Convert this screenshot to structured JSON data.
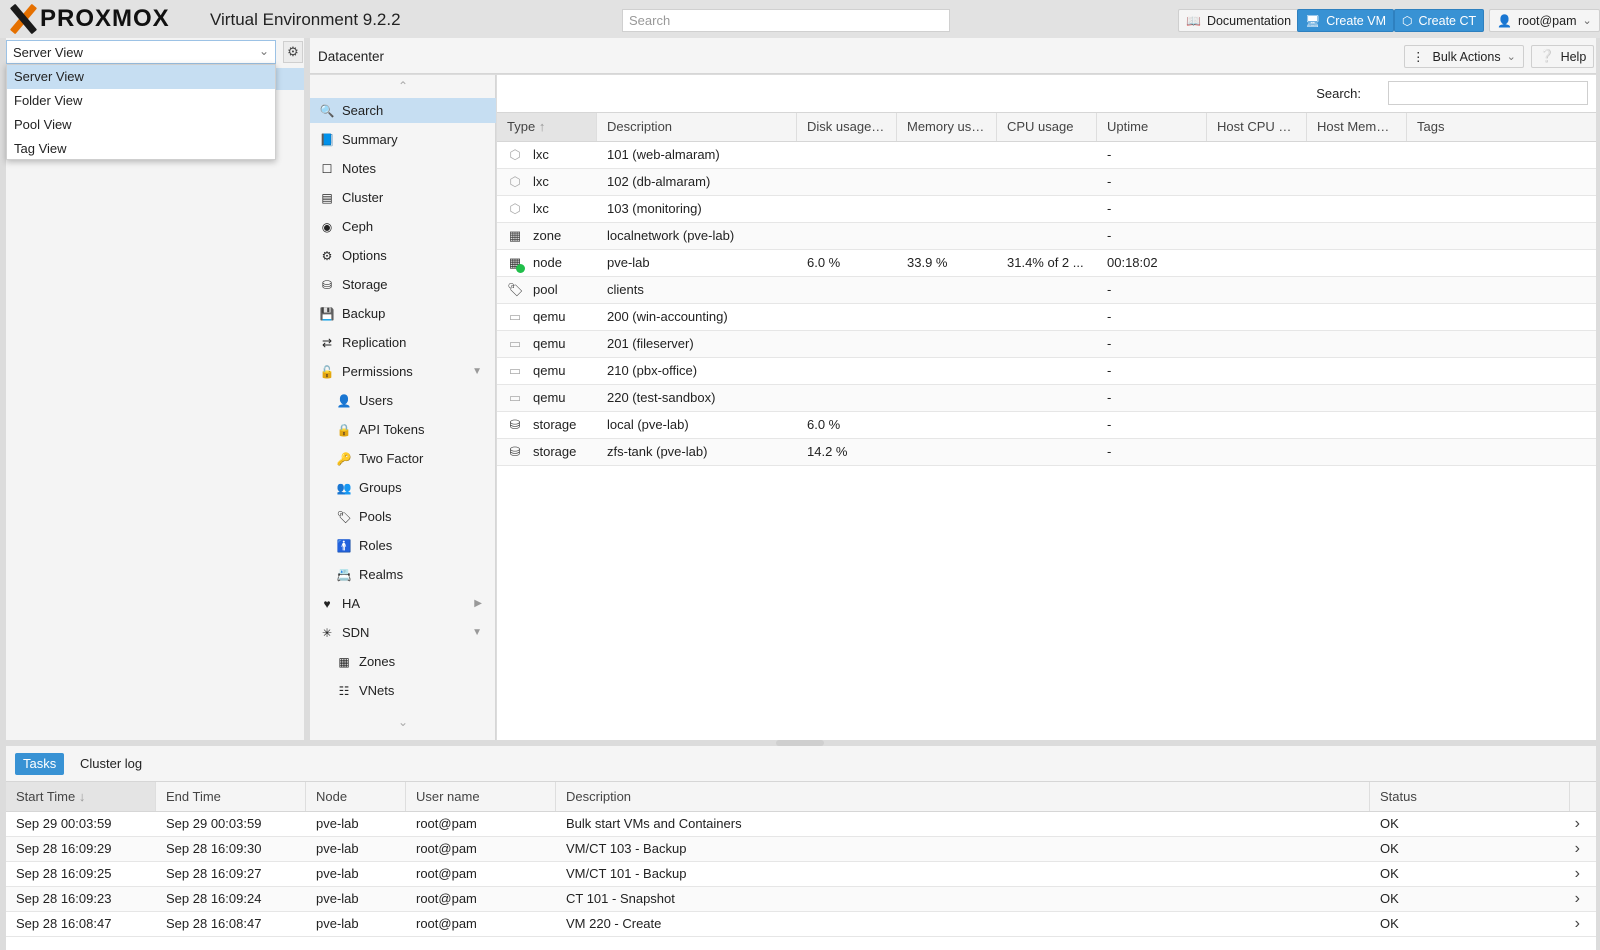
{
  "header": {
    "logo_text": "PROXMOX",
    "app_title": "Virtual Environment 9.2.2",
    "search_placeholder": "Search",
    "documentation_label": "Documentation",
    "create_vm_label": "Create VM",
    "create_ct_label": "Create CT",
    "user_label": "root@pam"
  },
  "view_selector": {
    "selected": "Server View",
    "options": [
      "Server View",
      "Folder View",
      "Pool View",
      "Tag View"
    ]
  },
  "content": {
    "title": "Datacenter",
    "bulk_actions_label": "Bulk Actions",
    "help_label": "Help"
  },
  "nav": {
    "items": [
      {
        "label": "Search",
        "icon": "search-icon"
      },
      {
        "label": "Summary",
        "icon": "book-icon"
      },
      {
        "label": "Notes",
        "icon": "note-icon"
      },
      {
        "label": "Cluster",
        "icon": "server-icon"
      },
      {
        "label": "Ceph",
        "icon": "ceph-icon"
      },
      {
        "label": "Options",
        "icon": "gear-icon"
      },
      {
        "label": "Storage",
        "icon": "database-icon"
      },
      {
        "label": "Backup",
        "icon": "floppy-icon"
      },
      {
        "label": "Replication",
        "icon": "retweet-icon"
      },
      {
        "label": "Permissions",
        "icon": "unlock-icon"
      },
      {
        "label": "Users",
        "icon": "user-icon"
      },
      {
        "label": "API Tokens",
        "icon": "lock-icon"
      },
      {
        "label": "Two Factor",
        "icon": "key-icon"
      },
      {
        "label": "Groups",
        "icon": "users-icon"
      },
      {
        "label": "Pools",
        "icon": "tags-icon"
      },
      {
        "label": "Roles",
        "icon": "male-icon"
      },
      {
        "label": "Realms",
        "icon": "address-book-icon"
      },
      {
        "label": "HA",
        "icon": "heartbeat-icon"
      },
      {
        "label": "SDN",
        "icon": "sdn-icon"
      },
      {
        "label": "Zones",
        "icon": "grid-icon"
      },
      {
        "label": "VNets",
        "icon": "network-icon"
      }
    ]
  },
  "grid": {
    "search_label": "Search:",
    "search_value": "",
    "columns": [
      "Type",
      "Description",
      "Disk usage…",
      "Memory us…",
      "CPU usage",
      "Uptime",
      "Host CPU …",
      "Host Mem…",
      "Tags"
    ],
    "rows": [
      {
        "type": "lxc",
        "icon": "container-icon",
        "description": "101 (web-almaram)",
        "disk": "",
        "memory": "",
        "cpu": "",
        "uptime": "-"
      },
      {
        "type": "lxc",
        "icon": "container-icon",
        "description": "102 (db-almaram)",
        "disk": "",
        "memory": "",
        "cpu": "",
        "uptime": "-"
      },
      {
        "type": "lxc",
        "icon": "container-icon",
        "description": "103 (monitoring)",
        "disk": "",
        "memory": "",
        "cpu": "",
        "uptime": "-"
      },
      {
        "type": "zone",
        "icon": "grid-icon",
        "description": "localnetwork (pve-lab)",
        "disk": "",
        "memory": "",
        "cpu": "",
        "uptime": "-"
      },
      {
        "type": "node",
        "icon": "node-online-icon",
        "description": "pve-lab",
        "disk": "6.0 %",
        "memory": "33.9 %",
        "cpu": "31.4% of 2 ...",
        "uptime": "00:18:02"
      },
      {
        "type": "pool",
        "icon": "tags-icon",
        "description": "clients",
        "disk": "",
        "memory": "",
        "cpu": "",
        "uptime": "-"
      },
      {
        "type": "qemu",
        "icon": "monitor-icon",
        "description": "200 (win-accounting)",
        "disk": "",
        "memory": "",
        "cpu": "",
        "uptime": "-"
      },
      {
        "type": "qemu",
        "icon": "monitor-icon",
        "description": "201 (fileserver)",
        "disk": "",
        "memory": "",
        "cpu": "",
        "uptime": "-"
      },
      {
        "type": "qemu",
        "icon": "monitor-icon",
        "description": "210 (pbx-office)",
        "disk": "",
        "memory": "",
        "cpu": "",
        "uptime": "-"
      },
      {
        "type": "qemu",
        "icon": "monitor-icon",
        "description": "220 (test-sandbox)",
        "disk": "",
        "memory": "",
        "cpu": "",
        "uptime": "-"
      },
      {
        "type": "storage",
        "icon": "database-icon",
        "description": "local (pve-lab)",
        "disk": "6.0 %",
        "memory": "",
        "cpu": "",
        "uptime": "-"
      },
      {
        "type": "storage",
        "icon": "database-icon",
        "description": "zfs-tank (pve-lab)",
        "disk": "14.2 %",
        "memory": "",
        "cpu": "",
        "uptime": "-"
      }
    ]
  },
  "bottom": {
    "tabs": [
      "Tasks",
      "Cluster log"
    ],
    "columns": [
      "Start Time",
      "End Time",
      "Node",
      "User name",
      "Description",
      "Status"
    ],
    "rows": [
      {
        "start": "Sep 29 00:03:59",
        "end": "Sep 29 00:03:59",
        "node": "pve-lab",
        "user": "root@pam",
        "description": "Bulk start VMs and Containers",
        "status": "OK"
      },
      {
        "start": "Sep 28 16:09:29",
        "end": "Sep 28 16:09:30",
        "node": "pve-lab",
        "user": "root@pam",
        "description": "VM/CT 103 - Backup",
        "status": "OK"
      },
      {
        "start": "Sep 28 16:09:25",
        "end": "Sep 28 16:09:27",
        "node": "pve-lab",
        "user": "root@pam",
        "description": "VM/CT 101 - Backup",
        "status": "OK"
      },
      {
        "start": "Sep 28 16:09:23",
        "end": "Sep 28 16:09:24",
        "node": "pve-lab",
        "user": "root@pam",
        "description": "CT 101 - Snapshot",
        "status": "OK"
      },
      {
        "start": "Sep 28 16:08:47",
        "end": "Sep 28 16:08:47",
        "node": "pve-lab",
        "user": "root@pam",
        "description": "VM 220 - Create",
        "status": "OK"
      }
    ]
  },
  "colors": {
    "accent": "#3892d4",
    "selection": "#c6def2",
    "logo_orange": "#e57000"
  }
}
